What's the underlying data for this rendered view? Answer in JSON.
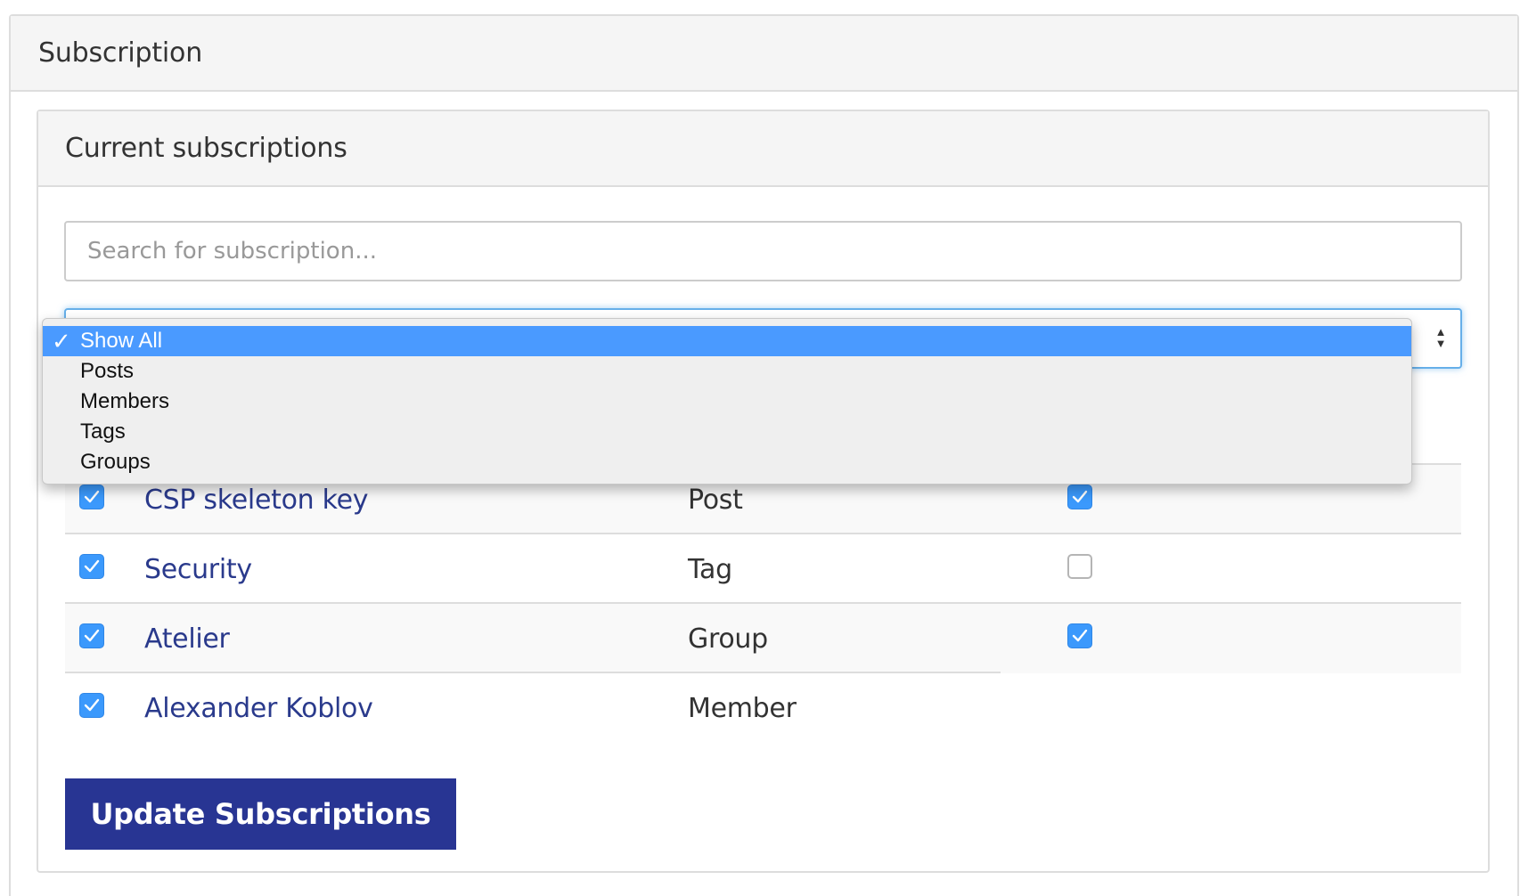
{
  "outer_panel": {
    "title": "Subscription"
  },
  "inner_panel": {
    "title": "Current subscriptions"
  },
  "search": {
    "placeholder": "Search for subscription..."
  },
  "filter": {
    "selected": "Show All",
    "options": [
      "Show All",
      "Posts",
      "Members",
      "Tags",
      "Groups"
    ]
  },
  "subscriptions": [
    {
      "name": "CSP skeleton key",
      "type": "Post",
      "subscribed": true,
      "option_checked": true
    },
    {
      "name": "Security",
      "type": "Tag",
      "subscribed": true,
      "option_checked": false
    },
    {
      "name": "Atelier",
      "type": "Group",
      "subscribed": true,
      "option_checked": true
    },
    {
      "name": "Alexander Koblov",
      "type": "Member",
      "subscribed": true,
      "option_checked": null
    }
  ],
  "actions": {
    "update_label": "Update Subscriptions"
  },
  "colors": {
    "link": "#2a3a8c",
    "button": "#283593",
    "checkbox": "#3b99fc",
    "dropdown_highlight": "#4a9aff"
  }
}
